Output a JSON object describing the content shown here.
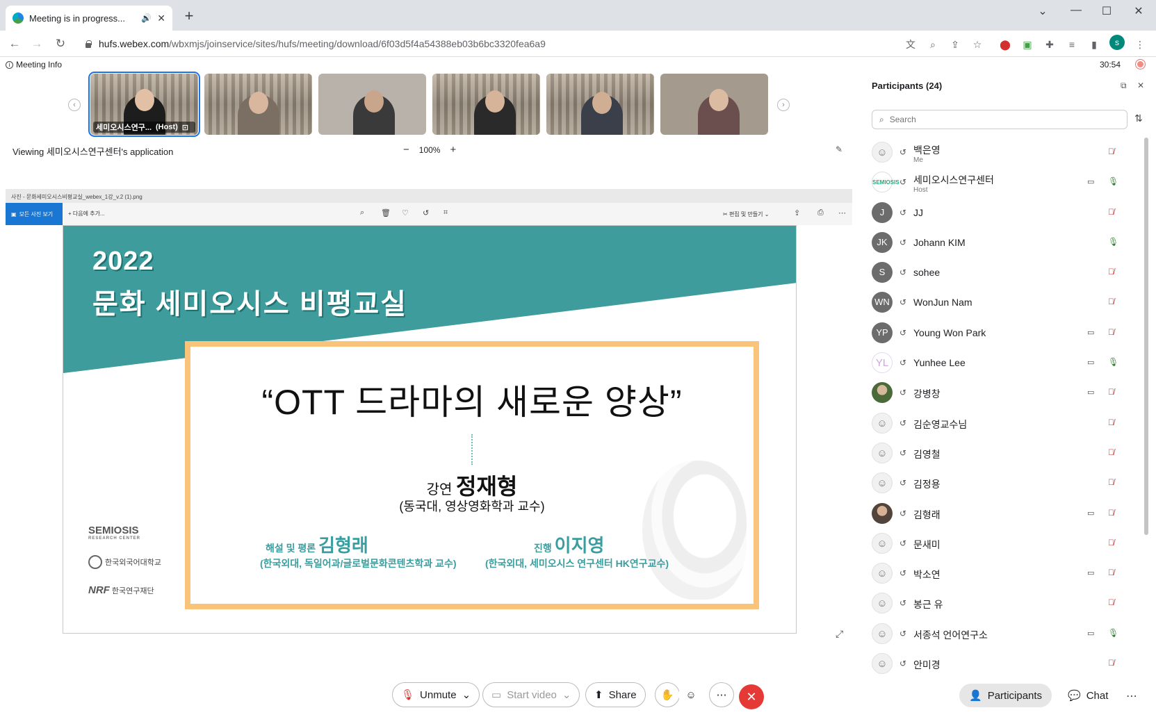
{
  "browser": {
    "tab_title": "Meeting is in progress...",
    "url_host": "hufs.webex.com",
    "url_path": "/wbxmjs/joinservice/sites/hufs/meeting/download/6f03d5f4a54388eb03b6bc3320fea6a9",
    "profile_initial": "s"
  },
  "meeting": {
    "info_label": "Meeting Info",
    "timer": "30:54",
    "viewing_prefix": "Viewing ",
    "viewing_name": "세미오시스연구센터",
    "viewing_suffix": "'s application",
    "zoom_level": "100%",
    "host_thumb_label": "세미오시스연구...",
    "host_tag": "(Host)"
  },
  "photos_app": {
    "title": "사진 - 문화세미오시스비평교실_webex_1강_v.2 (1).png",
    "all_photos": "모든 사진 보기",
    "add_to": "다음에 추가...",
    "edit_create": "편집 및 만들기"
  },
  "slide": {
    "year": "2022",
    "course": "문화 세미오시스 비평교실",
    "main_title": "“OTT 드라마의 새로운 양상”",
    "lecture_label": "강연",
    "lecturer": "정재형",
    "lecturer_aff": "(동국대, 영상영화학과 교수)",
    "commentary_label": "해설 및 평론",
    "commentator": "김형래",
    "commentator_aff": "(한국외대, 독일어과/글로벌문화콘텐츠학과 교수)",
    "host_label": "진행",
    "host_name": "이지영",
    "host_aff": "(한국외대, 세미오시스 연구센터 HK연구교수)",
    "logo_semiosis": "SEMIOSIS",
    "logo_semiosis_sub": "RESEARCH CENTER",
    "logo_hufs": "한국외국어대학교",
    "logo_nrf": "NRF",
    "logo_nrf_text": "한국연구재단"
  },
  "participants": {
    "title": "Participants (24)",
    "search_placeholder": "Search",
    "list": [
      {
        "name": "백은영",
        "sub": "Me",
        "initials": "",
        "avatar": "ghost",
        "video": false,
        "mic": "muted"
      },
      {
        "name": "세미오시스연구센터",
        "sub": "Host",
        "initials": "SEMIOSIS",
        "avatar": "semio",
        "video": true,
        "mic": "on"
      },
      {
        "name": "JJ",
        "sub": "",
        "initials": "J",
        "avatar": "initials",
        "video": false,
        "mic": "muted"
      },
      {
        "name": "Johann KIM",
        "sub": "",
        "initials": "JK",
        "avatar": "initials",
        "video": false,
        "mic": "on"
      },
      {
        "name": "sohee",
        "sub": "",
        "initials": "S",
        "avatar": "initials",
        "video": false,
        "mic": "muted"
      },
      {
        "name": "WonJun Nam",
        "sub": "",
        "initials": "WN",
        "avatar": "initials",
        "video": false,
        "mic": "muted"
      },
      {
        "name": "Young Won Park",
        "sub": "",
        "initials": "YP",
        "avatar": "initials",
        "video": true,
        "mic": "muted"
      },
      {
        "name": "Yunhee Lee",
        "sub": "",
        "initials": "YL",
        "avatar": "yl",
        "video": true,
        "mic": "on"
      },
      {
        "name": "강병창",
        "sub": "",
        "initials": "",
        "avatar": "photo",
        "video": true,
        "mic": "muted"
      },
      {
        "name": "김순영교수님",
        "sub": "",
        "initials": "",
        "avatar": "ghost",
        "video": false,
        "mic": "muted"
      },
      {
        "name": "김영철",
        "sub": "",
        "initials": "",
        "avatar": "ghost",
        "video": false,
        "mic": "muted"
      },
      {
        "name": "김정용",
        "sub": "",
        "initials": "",
        "avatar": "ghost",
        "video": false,
        "mic": "muted"
      },
      {
        "name": "김형래",
        "sub": "",
        "initials": "",
        "avatar": "photo2",
        "video": true,
        "mic": "muted"
      },
      {
        "name": "문새미",
        "sub": "",
        "initials": "",
        "avatar": "ghost",
        "video": false,
        "mic": "muted"
      },
      {
        "name": "박소연",
        "sub": "",
        "initials": "",
        "avatar": "ghost",
        "video": true,
        "mic": "muted"
      },
      {
        "name": "봉근 유",
        "sub": "",
        "initials": "",
        "avatar": "ghost",
        "video": false,
        "mic": "muted"
      },
      {
        "name": "서종석 언어연구소",
        "sub": "",
        "initials": "",
        "avatar": "ghost",
        "video": true,
        "mic": "on"
      },
      {
        "name": "안미경",
        "sub": "",
        "initials": "",
        "avatar": "ghost",
        "video": false,
        "mic": "muted"
      }
    ]
  },
  "controls": {
    "unmute": "Unmute",
    "start_video": "Start video",
    "share": "Share",
    "participants": "Participants",
    "chat": "Chat"
  },
  "colors": {
    "teal_banner": "#3f9c9c",
    "frame_orange": "#f9c47a",
    "leave_red": "#e53935",
    "active_blue": "#1a73e8"
  }
}
